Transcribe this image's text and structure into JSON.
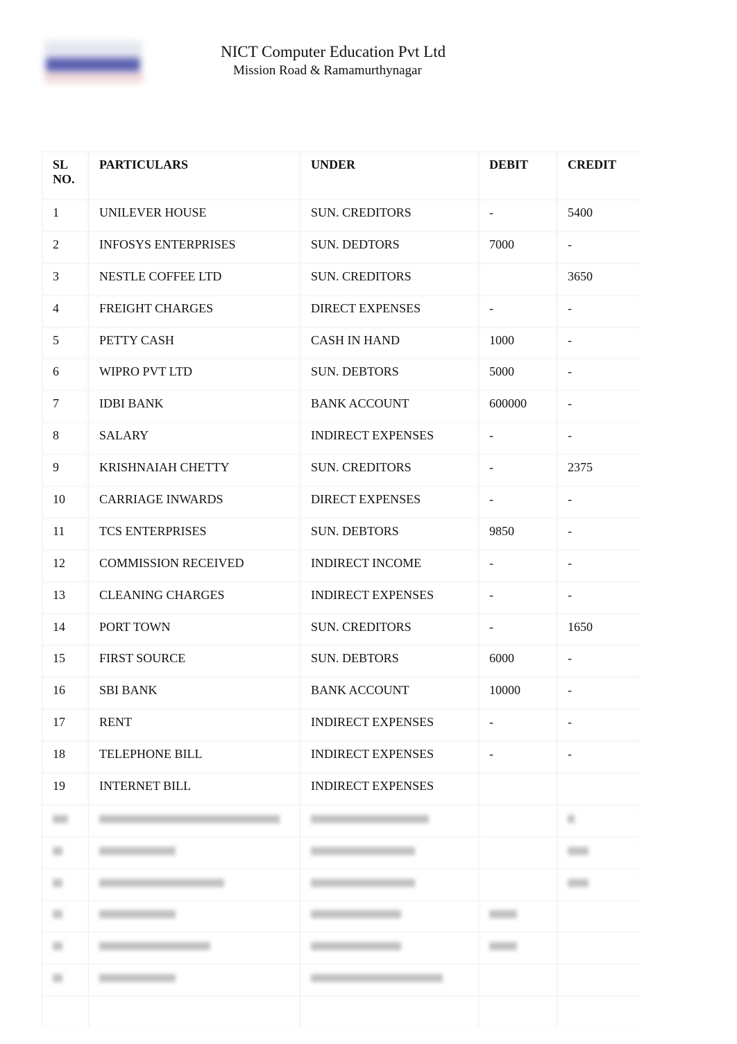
{
  "header": {
    "logo": "company-logo",
    "title": "NICT Computer Education Pvt Ltd",
    "subtitle": "Mission Road & Ramamurthynagar"
  },
  "table": {
    "columns": [
      "SL NO.",
      "PARTICULARS",
      "UNDER",
      "DEBIT",
      "CREDIT"
    ],
    "rows": [
      {
        "sl": "1",
        "particulars": "UNILEVER HOUSE",
        "under": "SUN. CREDITORS",
        "debit": "-",
        "credit": "5400"
      },
      {
        "sl": "2",
        "particulars": "INFOSYS ENTERPRISES",
        "under": "SUN. DEDTORS",
        "debit": "7000",
        "credit": "-"
      },
      {
        "sl": "3",
        "particulars": "NESTLE COFFEE LTD",
        "under": "SUN. CREDITORS",
        "debit": "",
        "credit": "3650"
      },
      {
        "sl": "4",
        "particulars": "FREIGHT CHARGES",
        "under": "DIRECT EXPENSES",
        "debit": "-",
        "credit": "-"
      },
      {
        "sl": "5",
        "particulars": "PETTY CASH",
        "under": "CASH IN HAND",
        "debit": "1000",
        "credit": "-"
      },
      {
        "sl": "6",
        "particulars": "WIPRO PVT LTD",
        "under": "SUN. DEBTORS",
        "debit": "5000",
        "credit": "-"
      },
      {
        "sl": "7",
        "particulars": "IDBI BANK",
        "under": "BANK ACCOUNT",
        "debit": "600000",
        "credit": "-"
      },
      {
        "sl": "8",
        "particulars": "SALARY",
        "under": "INDIRECT EXPENSES",
        "debit": "-",
        "credit": "-"
      },
      {
        "sl": "9",
        "particulars": "KRISHNAIAH CHETTY",
        "under": "SUN. CREDITORS",
        "debit": "-",
        "credit": "2375"
      },
      {
        "sl": "10",
        "particulars": "CARRIAGE INWARDS",
        "under": "DIRECT EXPENSES",
        "debit": "-",
        "credit": "-"
      },
      {
        "sl": "11",
        "particulars": "TCS ENTERPRISES",
        "under": "SUN. DEBTORS",
        "debit": "9850",
        "credit": "-"
      },
      {
        "sl": "12",
        "particulars": "COMMISSION RECEIVED",
        "under": "INDIRECT INCOME",
        "debit": "-",
        "credit": "-"
      },
      {
        "sl": "13",
        "particulars": "CLEANING CHARGES",
        "under": "INDIRECT EXPENSES",
        "debit": "-",
        "credit": "-"
      },
      {
        "sl": "14",
        "particulars": "PORT TOWN",
        "under": "SUN. CREDITORS",
        "debit": "-",
        "credit": "1650"
      },
      {
        "sl": "15",
        "particulars": "FIRST SOURCE",
        "under": "SUN. DEBTORS",
        "debit": "6000",
        "credit": "-"
      },
      {
        "sl": "16",
        "particulars": "SBI BANK",
        "under": "BANK ACCOUNT",
        "debit": "10000",
        "credit": "-"
      },
      {
        "sl": "17",
        "particulars": "RENT",
        "under": "INDIRECT EXPENSES",
        "debit": "-",
        "credit": "-"
      },
      {
        "sl": "18",
        "particulars": "TELEPHONE BILL",
        "under": "INDIRECT EXPENSES",
        "debit": "-",
        "credit": "-"
      },
      {
        "sl": "19",
        "particulars": "INTERNET BILL",
        "under": "INDIRECT EXPENSES",
        "debit": "",
        "credit": ""
      }
    ],
    "blurred_rows_note": "rows 20-25 obscured"
  }
}
